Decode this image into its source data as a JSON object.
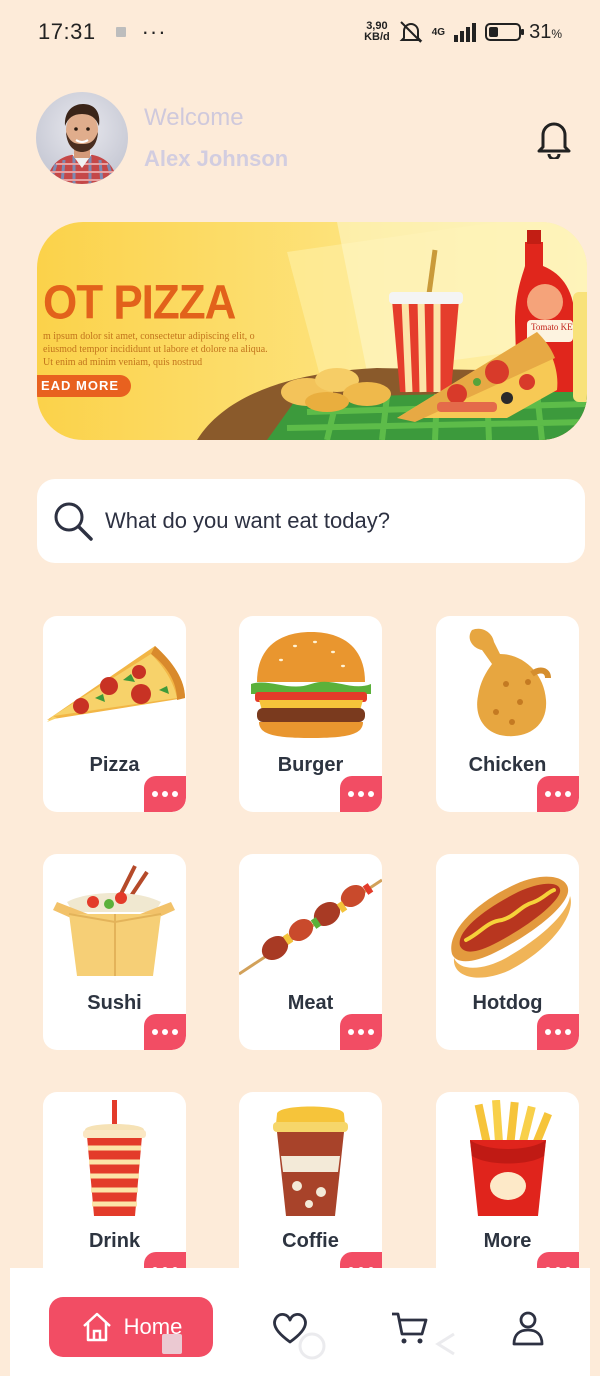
{
  "status_bar": {
    "time": "17:31",
    "speed_value": "3,90",
    "speed_unit": "KB/d",
    "network": "4G",
    "battery_percent": "31",
    "battery_unit": "%",
    "battery_level": 0.31
  },
  "header": {
    "welcome": "Welcome",
    "user_name": "Alex Johnson"
  },
  "banner": {
    "title": "OT PIZZA",
    "description": "m ipsum dolor sit amet, consectetur adipiscing elit, o eiusmod tempor incididunt ut labore et dolore na aliqua. Ut enim ad minim veniam, quis nostrud",
    "button_label": "EAD MORE",
    "ketchup_label": "Tomato KETCHUP"
  },
  "search": {
    "placeholder": "What do you want eat today?"
  },
  "categories": [
    {
      "label": "Pizza",
      "icon": "pizza-slice-icon"
    },
    {
      "label": "Burger",
      "icon": "burger-icon"
    },
    {
      "label": "Chicken",
      "icon": "chicken-leg-icon"
    },
    {
      "label": "Sushi",
      "icon": "noodle-box-icon"
    },
    {
      "label": "Meat",
      "icon": "skewer-icon"
    },
    {
      "label": "Hotdog",
      "icon": "hotdog-icon"
    },
    {
      "label": "Drink",
      "icon": "drink-cup-icon"
    },
    {
      "label": "Coffie",
      "icon": "coffee-cup-icon"
    },
    {
      "label": "More",
      "icon": "fries-icon"
    }
  ],
  "bottom_nav": {
    "home_label": "Home",
    "items": [
      "home-icon",
      "heart-icon",
      "cart-icon",
      "user-icon"
    ]
  },
  "colors": {
    "background": "#fdebd9",
    "accent": "#f24d64",
    "card": "#ffffff",
    "text": "#2d3440"
  }
}
